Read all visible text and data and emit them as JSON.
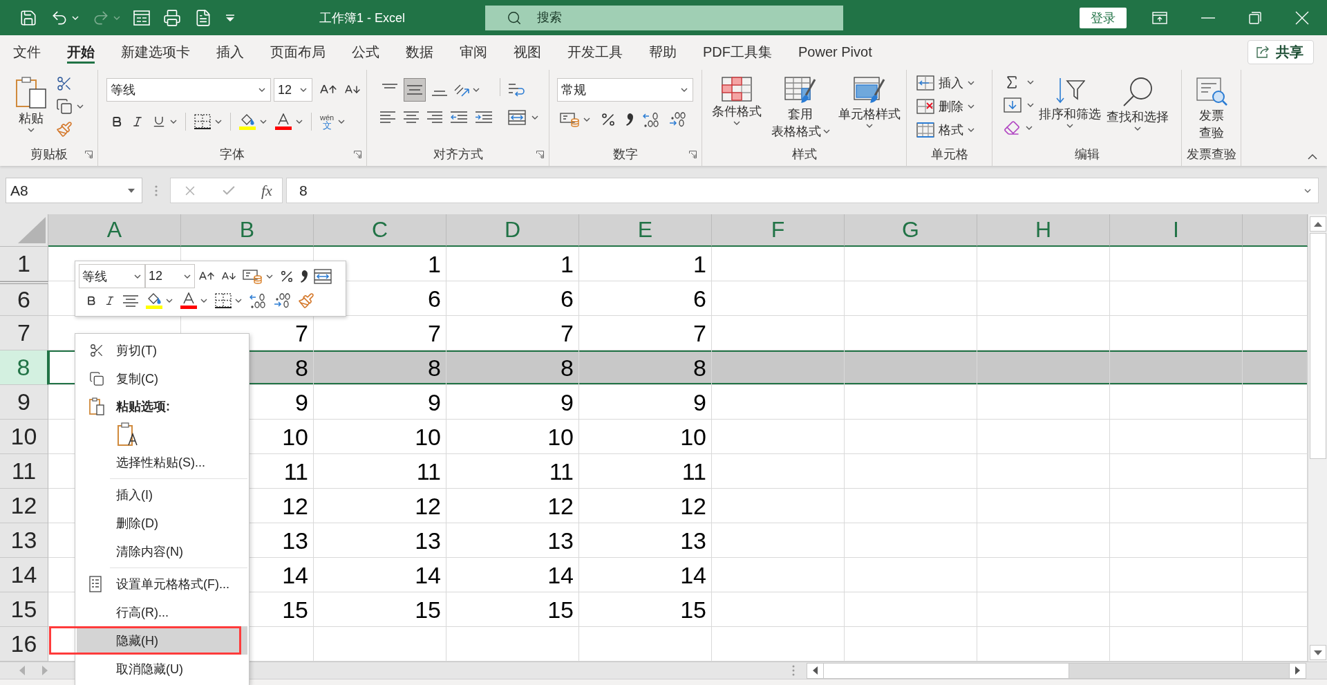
{
  "title_bar": {
    "quick_access": [
      {
        "kind": "save",
        "disabled": false
      },
      {
        "kind": "undo",
        "disabled": false
      },
      {
        "kind": "redo",
        "disabled": true
      },
      {
        "kind": "form",
        "disabled": false
      },
      {
        "kind": "print",
        "disabled": false
      },
      {
        "kind": "document",
        "disabled": false
      },
      {
        "kind": "customize",
        "disabled": false
      }
    ],
    "title": "工作簿1 - Excel",
    "search": {
      "placeholder": "搜索"
    },
    "sign_in": "登录"
  },
  "tabs": [
    {
      "label": "文件",
      "selected": false
    },
    {
      "label": "开始",
      "selected": true
    },
    {
      "label": "新建选项卡",
      "selected": false
    },
    {
      "label": "插入",
      "selected": false
    },
    {
      "label": "页面布局",
      "selected": false
    },
    {
      "label": "公式",
      "selected": false
    },
    {
      "label": "数据",
      "selected": false
    },
    {
      "label": "审阅",
      "selected": false
    },
    {
      "label": "视图",
      "selected": false
    },
    {
      "label": "开发工具",
      "selected": false
    },
    {
      "label": "帮助",
      "selected": false
    },
    {
      "label": "PDF工具集",
      "selected": false
    },
    {
      "label": "Power Pivot",
      "selected": false
    }
  ],
  "share": "共享",
  "ribbon": {
    "groups": [
      {
        "kind": "clipboard",
        "label": "剪贴板",
        "launcher": true,
        "paste": "粘贴"
      },
      {
        "kind": "font",
        "label": "字体",
        "launcher": true,
        "font_name": "等线",
        "font_size": "12",
        "phonetic": {
          "pinyin": "wén",
          "character": "文"
        }
      },
      {
        "kind": "alignment",
        "label": "对齐方式",
        "launcher": true,
        "vertical": [
          {
            "kind": "top",
            "selected": false
          },
          {
            "kind": "middle",
            "selected": true
          },
          {
            "kind": "bottom",
            "selected": false
          }
        ]
      },
      {
        "kind": "number",
        "label": "数字",
        "launcher": true,
        "format": "常规"
      },
      {
        "kind": "styles",
        "label": "样式",
        "launcher": false,
        "buttons": [
          {
            "kind": "conditional",
            "lines": [
              "条件格式"
            ],
            "dropdown": true
          },
          {
            "kind": "table",
            "lines": [
              "套用",
              "表格格式"
            ],
            "dropdown": true
          },
          {
            "kind": "cell",
            "lines": [
              "单元格样式"
            ],
            "dropdown": true
          }
        ]
      },
      {
        "kind": "cells",
        "label": "单元格",
        "launcher": false,
        "buttons": [
          {
            "kind": "insert",
            "label": "插入",
            "dropdown": true
          },
          {
            "kind": "delete",
            "label": "删除",
            "dropdown": true
          },
          {
            "kind": "format",
            "label": "格式",
            "dropdown": true
          }
        ]
      },
      {
        "kind": "editing",
        "label": "编辑",
        "launcher": false,
        "buttons": [
          {
            "kind": "sort",
            "lines": [
              "排序和筛选"
            ],
            "dropdown": true
          },
          {
            "kind": "find",
            "lines": [
              "查找和选择"
            ],
            "dropdown": true
          }
        ]
      },
      {
        "kind": "invoice",
        "label": "发票查验",
        "launcher": false,
        "buttons": [
          {
            "kind": "invoice",
            "lines": [
              "发票",
              "查验"
            ],
            "dropdown": false
          }
        ]
      }
    ]
  },
  "formula_bar": {
    "name_box": "A8",
    "function": "fx",
    "value": "8"
  },
  "sheet": {
    "columns": [
      {
        "label": "A",
        "selected": true
      },
      {
        "label": "B",
        "selected": true
      },
      {
        "label": "C",
        "selected": true
      },
      {
        "label": "D",
        "selected": true
      },
      {
        "label": "E",
        "selected": true
      },
      {
        "label": "F",
        "selected": true
      },
      {
        "label": "G",
        "selected": true
      },
      {
        "label": "H",
        "selected": true
      },
      {
        "label": "I",
        "selected": true
      },
      {
        "selected": true
      }
    ],
    "rows": [
      {
        "header": "1",
        "selected": false,
        "hidden_above": false,
        "cells": [
          null,
          null,
          "1",
          "1",
          "1"
        ]
      },
      {
        "header": "6",
        "selected": false,
        "hidden_above": true,
        "cells": [
          null,
          null,
          "6",
          "6",
          "6"
        ]
      },
      {
        "header": "7",
        "selected": false,
        "hidden_above": false,
        "cells": [
          null,
          "7",
          "7",
          "7",
          "7"
        ]
      },
      {
        "header": "8",
        "selected": true,
        "hidden_above": false,
        "cells": [
          null,
          "8",
          "8",
          "8",
          "8"
        ]
      },
      {
        "header": "9",
        "selected": false,
        "hidden_above": false,
        "cells": [
          null,
          "9",
          "9",
          "9",
          "9"
        ]
      },
      {
        "header": "10",
        "selected": false,
        "hidden_above": false,
        "cells": [
          null,
          "10",
          "10",
          "10",
          "10"
        ]
      },
      {
        "header": "11",
        "selected": false,
        "hidden_above": false,
        "cells": [
          null,
          "11",
          "11",
          "11",
          "11"
        ]
      },
      {
        "header": "12",
        "selected": false,
        "hidden_above": false,
        "cells": [
          null,
          "12",
          "12",
          "12",
          "12"
        ]
      },
      {
        "header": "13",
        "selected": false,
        "hidden_above": false,
        "cells": [
          null,
          "13",
          "13",
          "13",
          "13"
        ]
      },
      {
        "header": "14",
        "selected": false,
        "hidden_above": false,
        "cells": [
          null,
          "14",
          "14",
          "14",
          "14"
        ]
      },
      {
        "header": "15",
        "selected": false,
        "hidden_above": false,
        "cells": [
          null,
          "15",
          "15",
          "15",
          "15"
        ]
      },
      {
        "header": "16",
        "selected": false,
        "hidden_above": false
      }
    ]
  },
  "mini_toolbar": {
    "font_name": "等线",
    "font_size": "12"
  },
  "context_menu": {
    "items": [
      {
        "kind": "cut",
        "label": "剪切(T)",
        "selected": false
      },
      {
        "kind": "copy",
        "label": "复制(C)",
        "selected": false
      },
      {
        "kind": "heading",
        "label": "粘贴选项:"
      },
      {
        "kind": "paste-option",
        "selected": false
      },
      {
        "kind": "plain",
        "label": "选择性粘贴(S)...",
        "selected": false
      },
      {
        "kind": "separator"
      },
      {
        "kind": "plain",
        "label": "插入(I)",
        "selected": false
      },
      {
        "kind": "plain",
        "label": "删除(D)",
        "selected": false
      },
      {
        "kind": "plain",
        "label": "清除内容(N)",
        "selected": false
      },
      {
        "kind": "separator"
      },
      {
        "kind": "format",
        "label": "设置单元格格式(F)...",
        "selected": false
      },
      {
        "kind": "plain",
        "label": "行高(R)...",
        "selected": false
      },
      {
        "kind": "plain",
        "label": "隐藏(H)",
        "selected": true
      },
      {
        "kind": "plain",
        "label": "取消隐藏(U)",
        "selected": false
      }
    ]
  }
}
